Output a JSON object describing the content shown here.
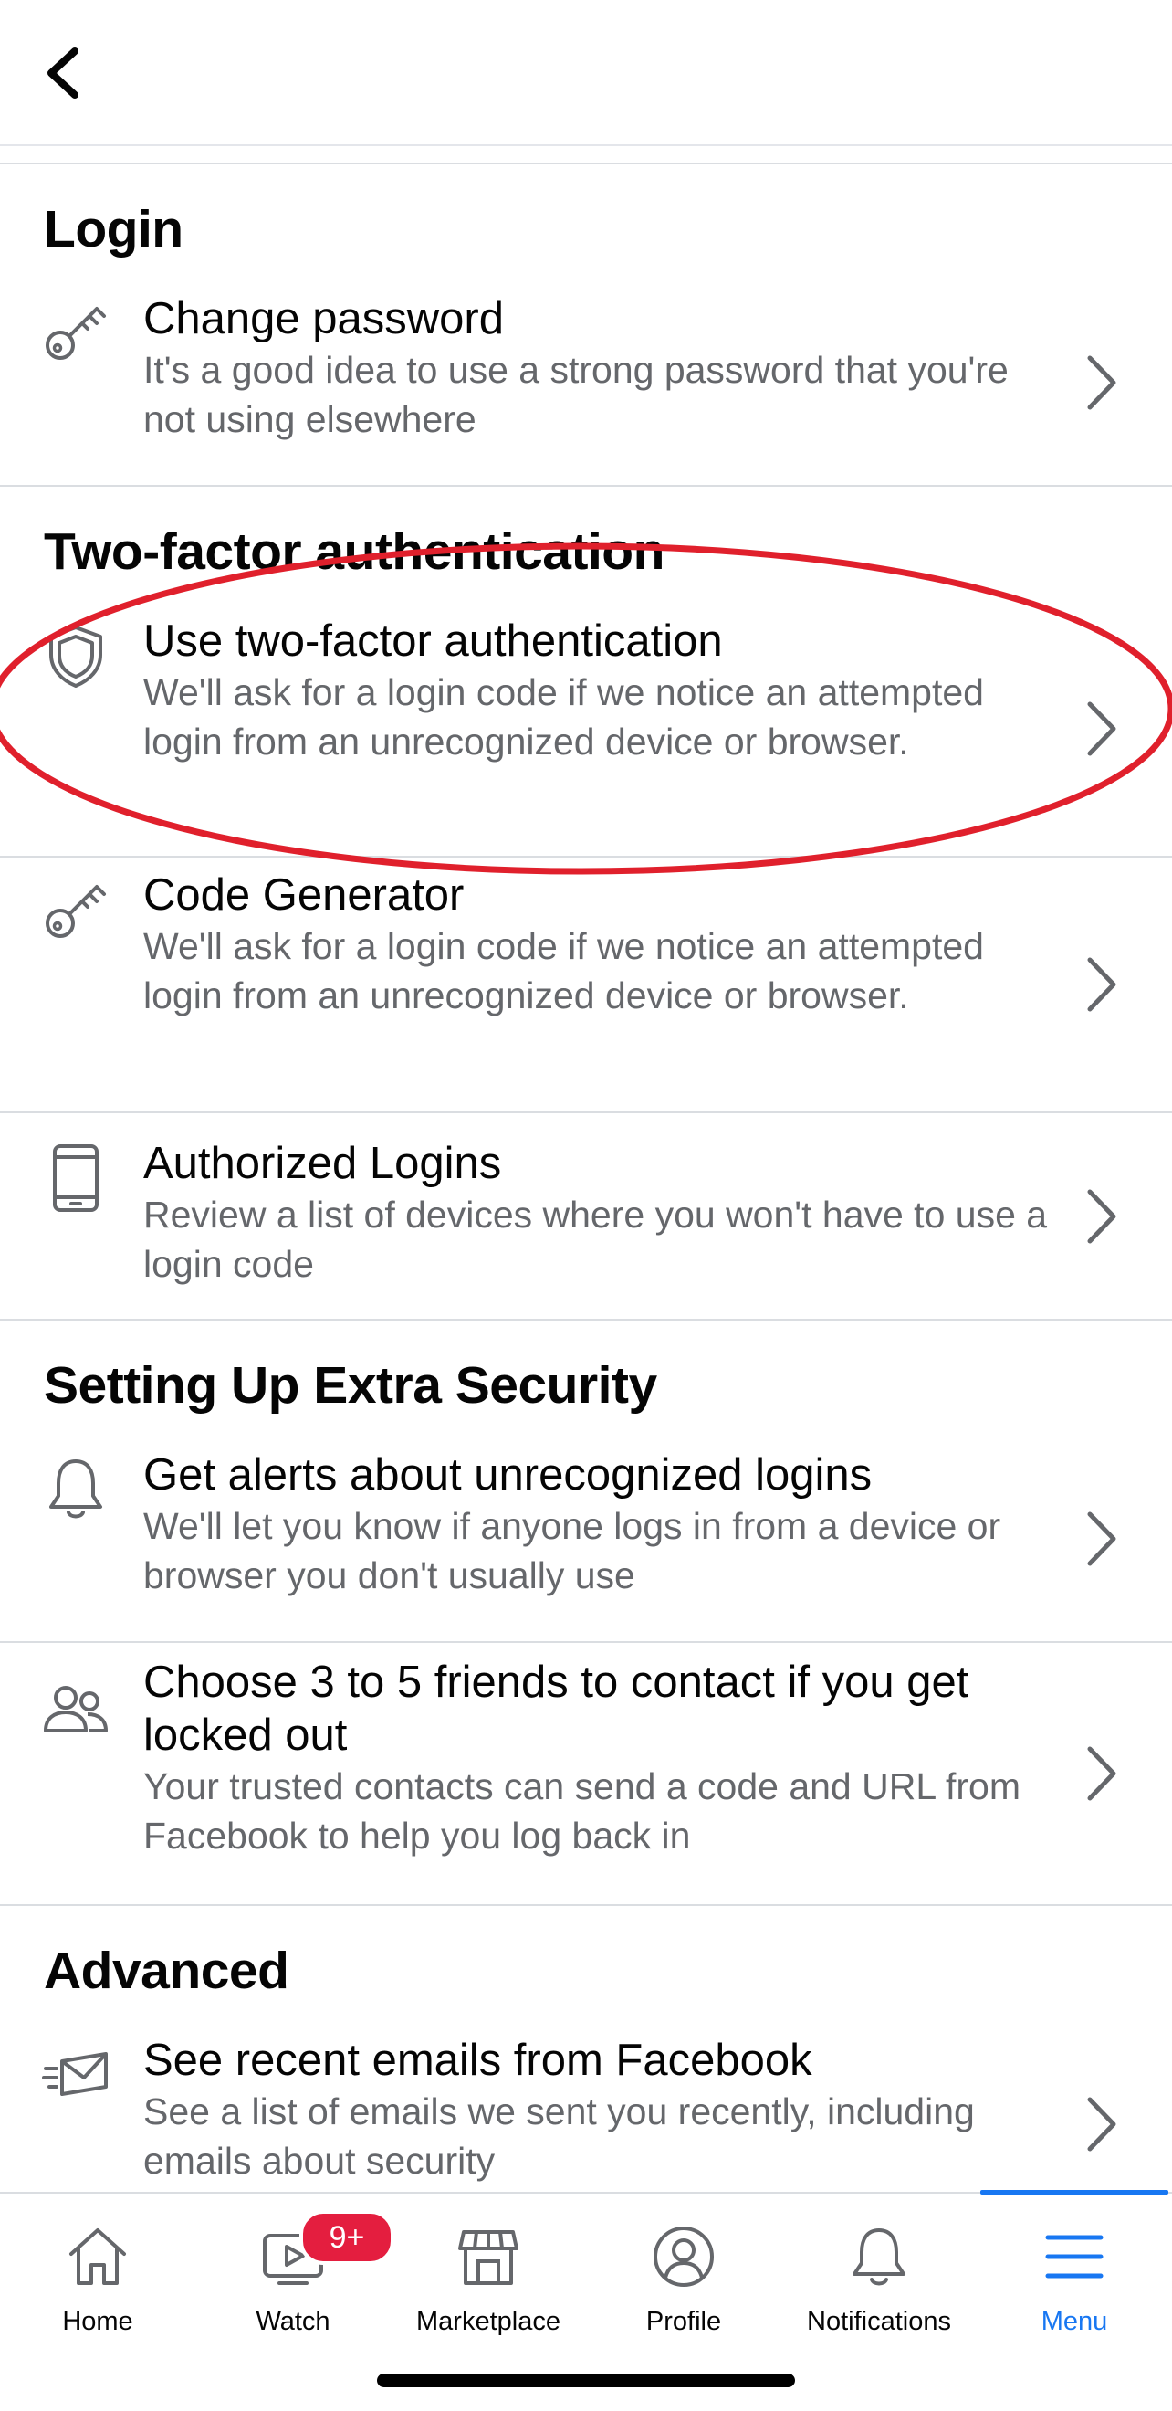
{
  "header": {
    "back_icon": "chevron-left-icon"
  },
  "sections": [
    {
      "heading": "Login",
      "items": [
        {
          "icon": "key-icon",
          "title": "Change password",
          "desc": "It's a good idea to use a strong password that you're not using elsewhere"
        }
      ]
    },
    {
      "heading": "Two-factor authentication",
      "items": [
        {
          "icon": "shield-icon",
          "title": "Use two-factor authentication",
          "desc": "We'll ask for a login code if we notice an attempted login from an unrecognized device or browser."
        },
        {
          "icon": "key-icon",
          "title": "Code Generator",
          "desc": "We'll ask for a login code if we notice an attempted login from an unrecognized device or browser."
        },
        {
          "icon": "phone-icon",
          "title": "Authorized Logins",
          "desc": "Review a list of devices where you won't have to use a login code"
        }
      ]
    },
    {
      "heading": "Setting Up Extra Security",
      "items": [
        {
          "icon": "bell-icon",
          "title": "Get alerts about unrecognized logins",
          "desc": "We'll let you know if anyone logs in from a device or browser you don't usually use"
        },
        {
          "icon": "friends-icon",
          "title": "Choose 3 to 5 friends to contact if you get locked out",
          "desc": "Your trusted contacts can send a code and URL from Facebook to help you log back in"
        }
      ]
    },
    {
      "heading": "Advanced",
      "items": [
        {
          "icon": "envelope-icon",
          "title": "See recent emails from Facebook",
          "desc": "See a list of emails we sent you recently, including emails about security"
        }
      ]
    }
  ],
  "tabbar": {
    "tabs": [
      {
        "label": "Home",
        "icon": "home-icon"
      },
      {
        "label": "Watch",
        "icon": "watch-icon",
        "badge": "9+"
      },
      {
        "label": "Marketplace",
        "icon": "marketplace-icon"
      },
      {
        "label": "Profile",
        "icon": "profile-icon"
      },
      {
        "label": "Notifications",
        "icon": "bell-icon"
      },
      {
        "label": "Menu",
        "icon": "menu-icon",
        "active": true
      }
    ]
  },
  "colors": {
    "accent": "#1877f2",
    "annotation_ellipse": "#e0202c",
    "badge": "#e41e3f",
    "secondary_text": "#65676b"
  }
}
